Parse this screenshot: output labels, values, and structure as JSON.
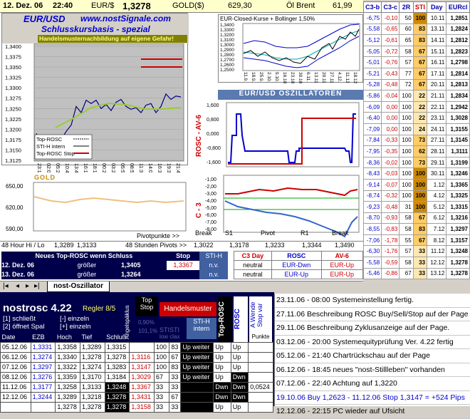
{
  "topbar": {
    "date": "12. Dez. 06",
    "time": "22:40",
    "eur_label": "EUR/$",
    "eur_value": "1,3278",
    "gold_label": "GOLD($)",
    "gold_value": "629,30",
    "oil_label": "Öl Brent",
    "oil_value": "61,99"
  },
  "main_chart": {
    "title": "EUR/USD",
    "url": "www.nostSignale.com",
    "subtitle": "Schlusskursbasis - spezial",
    "warning": "Handelsmusternachbildung auf eigene Gefahr!",
    "y_ticks": [
      "1,3400",
      "1,3375",
      "1,3350",
      "1,3325",
      "1,3300",
      "1,3275",
      "1,3250",
      "1,3225",
      "1,3200",
      "1,3175",
      "1,3150",
      "1,3125"
    ],
    "x_ticks": [
      "23:10",
      "02:01",
      "05:29",
      "10:42",
      "13:42",
      "16:12",
      "18:11",
      "00:28",
      "03:27",
      "05:53",
      "08:50",
      "11:31",
      "14:00",
      "16:30",
      "19:31",
      "21:41"
    ],
    "legend": [
      "Top-ROSC",
      "STI-H intern",
      "Top-ROSC Stop"
    ]
  },
  "bollinger_chart": {
    "title": "EUR-Closed-Kurse + Bollinger 1,50%",
    "y_ticks": [
      "1,3400",
      "1,3300",
      "1,3200",
      "1,3100",
      "1,3000",
      "1,2900",
      "1,2800",
      "1,2700",
      "1,2600",
      "1,2500"
    ],
    "x_ticks": [
      "11.9.",
      "18.9.",
      "25.9.",
      "2.10.",
      "9.10.",
      "16.10.",
      "23.10.",
      "30.10.",
      "6.11.",
      "13.11.",
      "20.11.",
      "27.11.",
      "4.12.",
      "11.12.",
      "18.12."
    ]
  },
  "oscillator": {
    "title": "EUR/USD OSZILLATOREN",
    "rosc_label": "ROSC - AV-6",
    "rosc_ticks": [
      "1,600",
      "0,800",
      "0,000",
      "-0,800",
      "-1,600"
    ],
    "c3_label": "C - 3",
    "c3_ticks": [
      "-1,00",
      "-2,00",
      "-3,00",
      "-4,00",
      "-5,00",
      "-6,00",
      "-7,00",
      "-8,00"
    ],
    "pivot_labels": [
      "Break",
      "S1",
      "Pivot",
      "R1",
      "Break"
    ],
    "pivot_values": [
      "1,3022",
      "1,3178",
      "1,3233",
      "1,3344",
      "1,3490"
    ],
    "pivot_caption": "48 Stunden Pivots >>",
    "pivotpunkte": "Pivotpunkte >>"
  },
  "gold_chart": {
    "title": "GOLD",
    "y_ticks": [
      "650,00",
      "620,00",
      "590,00"
    ]
  },
  "hilo": {
    "label": "48 Hour Hi / Lo",
    "hi": "1,3289",
    "lo": "1,3133"
  },
  "signals": {
    "header": "Neues Top-ROSC wenn Schluss",
    "stop_header": "Stop",
    "sti_header": "STI-H",
    "rows": [
      {
        "date": "12. Dez. 06",
        "cmp": "größer",
        "val": "1,3405",
        "stop": "1,3367",
        "sti": "n.v."
      },
      {
        "date": "13. Dez. 06",
        "cmp": "größer",
        "val": "1,3264",
        "stop": "",
        "sti": "n.v."
      }
    ],
    "c3_header": "C3 Day",
    "rosc_header": "ROSC",
    "av_header": "AV-6",
    "states": [
      {
        "c3": "neutral",
        "rosc": "EUR-Dwn",
        "av": "EUR-Up"
      },
      {
        "c3": "neutral",
        "rosc": "EUR-Up",
        "av": "EUR-Up"
      }
    ]
  },
  "right_table": {
    "headers": [
      "C3-b",
      "C3-c",
      "2R",
      "STI",
      "Day",
      "EURcl"
    ],
    "rows": [
      [
        "-6,75",
        "-0,10",
        "50",
        "100",
        "10.11",
        "1,2851"
      ],
      [
        "-5,58",
        "-0,65",
        "60",
        "83",
        "13.11",
        "1,2824"
      ],
      [
        "-5,12",
        "-0,61",
        "65",
        "83",
        "14.11",
        "1,2812"
      ],
      [
        "-5,05",
        "-0,72",
        "58",
        "67",
        "15.11",
        "1,2823"
      ],
      [
        "-5,01",
        "-0,76",
        "57",
        "67",
        "16.11",
        "1,2798"
      ],
      [
        "-5,21",
        "-0,43",
        "77",
        "67",
        "17.11",
        "1,2814"
      ],
      [
        "-5,28",
        "-0,48",
        "72",
        "67",
        "20.11",
        "1,2813"
      ],
      [
        "-5,86",
        "-0,04",
        "100",
        "22",
        "21.11",
        "1,2834"
      ],
      [
        "-6,09",
        "0,00",
        "100",
        "22",
        "22.11",
        "1,2942"
      ],
      [
        "-6,40",
        "0,00",
        "100",
        "22",
        "23.11",
        "1,3028"
      ],
      [
        "-7,09",
        "0,00",
        "100",
        "24",
        "24.11",
        "1,3155"
      ],
      [
        "-7,84",
        "-0,33",
        "100",
        "73",
        "27.11",
        "1,3145"
      ],
      [
        "-7,95",
        "-0,35",
        "100",
        "62",
        "28.11",
        "1,3111"
      ],
      [
        "-8,36",
        "-0,02",
        "100",
        "73",
        "29.11",
        "1,3199"
      ],
      [
        "-8,43",
        "-0,03",
        "100",
        "100",
        "30.11",
        "1,3246"
      ],
      [
        "-9,14",
        "-0,07",
        "100",
        "100",
        "1.12",
        "1,3365"
      ],
      [
        "-8,74",
        "-0,32",
        "100",
        "100",
        "4.12",
        "1,3325"
      ],
      [
        "-9,23",
        "-0,48",
        "31",
        "100",
        "5.12",
        "1,3315"
      ],
      [
        "-8,70",
        "-0,93",
        "58",
        "67",
        "6.12",
        "1,3216"
      ],
      [
        "-8,55",
        "-0,83",
        "58",
        "83",
        "7.12",
        "1,3297"
      ],
      [
        "-7,06",
        "-1,78",
        "55",
        "67",
        "8.12",
        "1,3157"
      ],
      [
        "-6,30",
        "-1,76",
        "57",
        "33",
        "11.12",
        "1,3248"
      ],
      [
        "-5,58",
        "-0,59",
        "58",
        "33",
        "12.12",
        "1,3278"
      ],
      [
        "-5,46",
        "-0,86",
        "67",
        "33",
        "13.12",
        "1,3278"
      ]
    ]
  },
  "tab": {
    "label": "nost-Oszillator"
  },
  "bottom": {
    "title": "nostrosc 4.22",
    "regler": "Regler 8/5",
    "opt1": "[1] schließt",
    "opt1b": "[-] einzeln",
    "opt2": "[2] öffnet Spal",
    "opt2b": "[+] einzeln",
    "cols": [
      "Date",
      "EZB",
      "Hoch",
      "Tief",
      "Schluß"
    ],
    "angle_label": "Angelspäklus",
    "top_stop": "Top Stop",
    "handel": "Handelsmuster",
    "sti_h": "STI-H intern",
    "top_rosc": "Top-ROSC",
    "rosc": "ROSC",
    "a_wende": "A Wende Stop var",
    "punkte": "Punkte",
    "stistl": "STISTI",
    "lowclax": "low clax",
    "pct1": "0,90%",
    "pct2": "101,1%",
    "rows": [
      [
        "05.12.06",
        "1,3331",
        "1,3358",
        "1,3289",
        "1,3315",
        "",
        "100",
        "83",
        "Up weiter",
        "Up",
        "Up",
        ""
      ],
      [
        "06.12.06",
        "1,3274",
        "1,3340",
        "1,3278",
        "1,3278",
        "1,3116",
        "100",
        "67",
        "Up weiter",
        "Up",
        "Up",
        ""
      ],
      [
        "07.12.06",
        "1,3297",
        "1,3322",
        "1,3274",
        "1,3283",
        "1,3147",
        "100",
        "83",
        "Up weiter",
        "Up",
        "Up",
        ""
      ],
      [
        "08.12.06",
        "1,3276",
        "1,3359",
        "1,3170",
        "1,3184",
        "1,3029",
        "67",
        "33",
        "Up weiter",
        "Up",
        "Dwn",
        ""
      ],
      [
        "11.12.06",
        "1,3177",
        "1,3258",
        "1,3133",
        "1,3248",
        "1,3367",
        "33",
        "33",
        "",
        "Dwn",
        "Dwn",
        "0,0524"
      ],
      [
        "12.12.06",
        "1,3244",
        "1,3289",
        "1,3218",
        "1,3278",
        "1,3431",
        "33",
        "67",
        "",
        "Dwn",
        "Dwn",
        ""
      ],
      [
        "",
        "",
        "1,3278",
        "1,3278",
        "1,3278",
        "1,3158",
        "33",
        "33",
        "",
        "Up",
        "Up",
        ""
      ]
    ]
  },
  "log": [
    "23.11.06 - 08:00 Systemeinstellung fertig.",
    "27.11.06 Beschreibung ROSC Buy/Sell/Stop auf der Page",
    "29.11.06 Beschreibung Zyklusanzeige auf der Page.",
    "03.12.06 - 20:00 Systemequityprüfung Ver. 4.22 fertig",
    "05.12.06 - 21:40 Chartrückschau auf der Page",
    "06.12.06 - 18:45 neues \"nost-Stillleben\" vorhanden",
    "07.12.06 - 22:40 Achtung auf 1,3220",
    "19.10.06 Buy 1,2623 - 11.12.06 Stop 1,3147 = +524 Pips",
    "12.12.06 - 22:15 PC wieder auf Ufsicht"
  ],
  "colors": {
    "accent": "#0000cc",
    "stop": "#cc0000",
    "header_bg": "#ffffcc",
    "dark": "#00004a"
  }
}
